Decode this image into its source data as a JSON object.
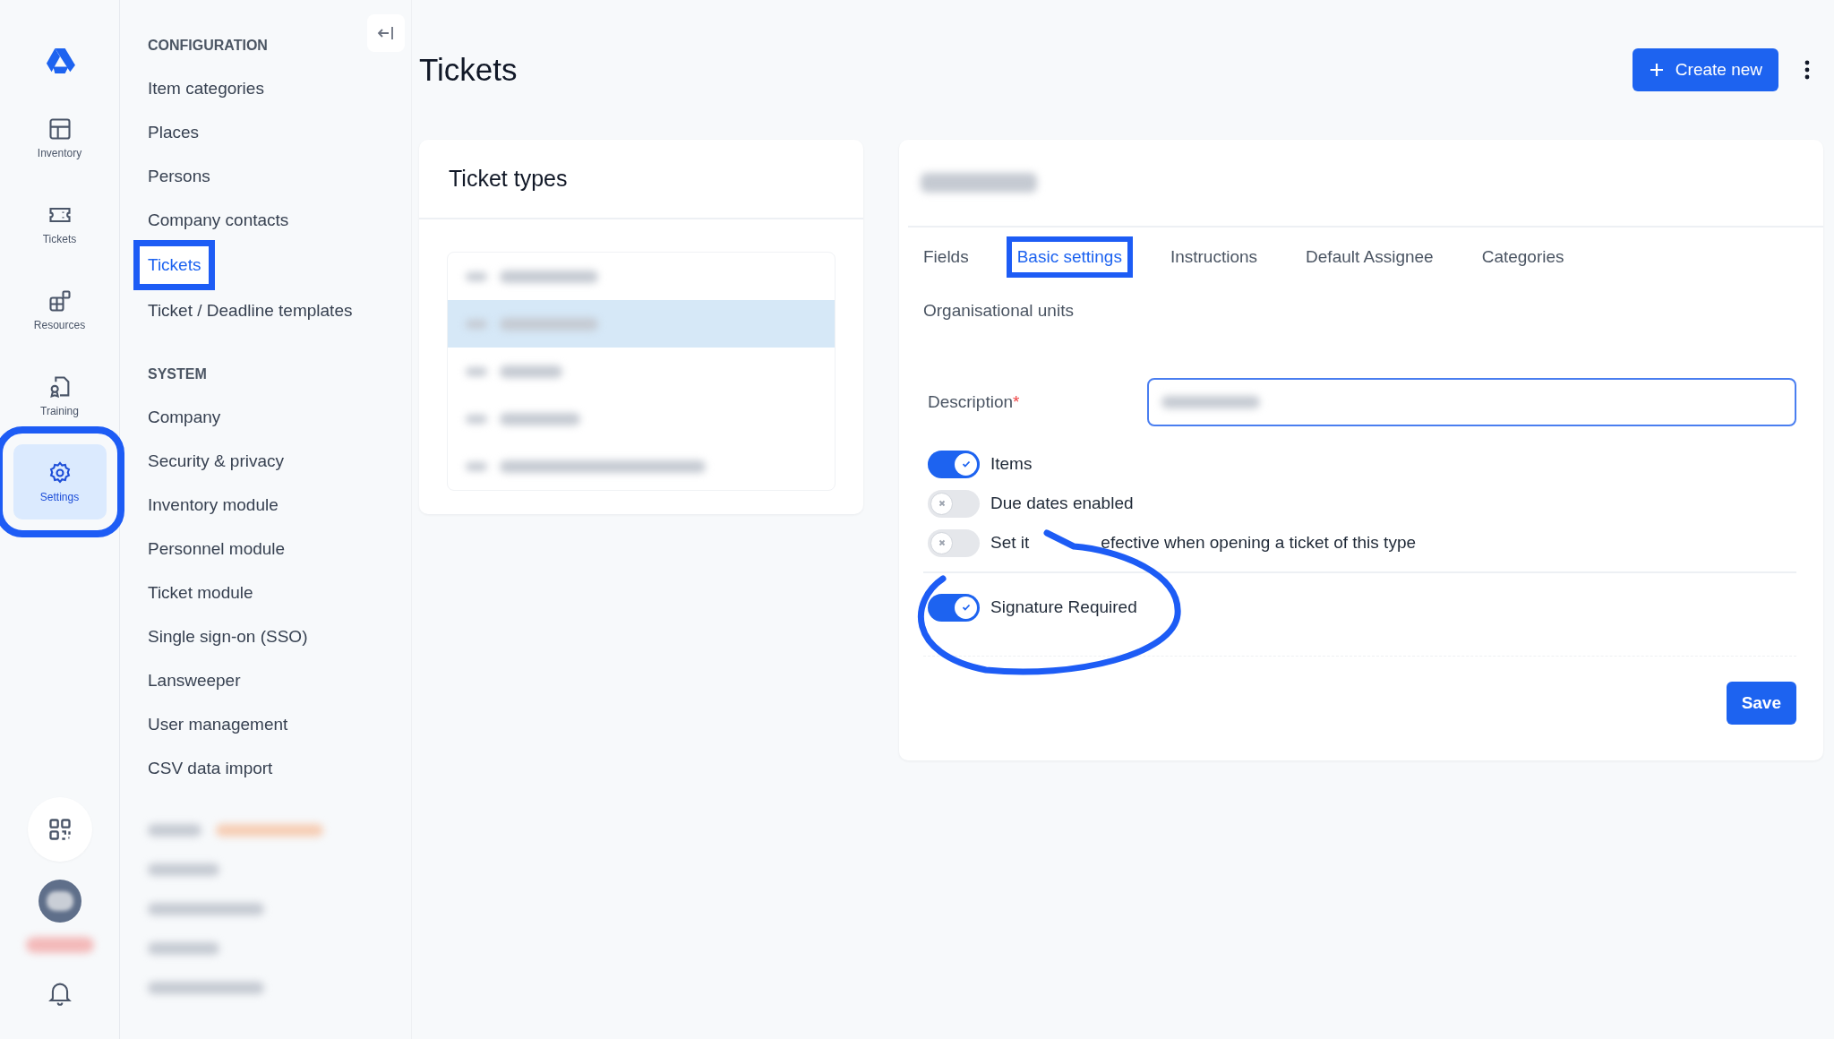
{
  "rail": {
    "items": [
      {
        "kind": "inventory",
        "label": "Inventory",
        "selected": false,
        "highlighted": false
      },
      {
        "kind": "tickets",
        "label": "Tickets",
        "selected": false,
        "highlighted": false
      },
      {
        "kind": "resources",
        "label": "Resources",
        "selected": false,
        "highlighted": false
      },
      {
        "kind": "training",
        "label": "Training",
        "selected": false,
        "highlighted": false
      },
      {
        "kind": "settings",
        "label": "Settings",
        "selected": true,
        "highlighted": true
      }
    ]
  },
  "sidebar": {
    "sections": [
      {
        "heading": "CONFIGURATION",
        "items": [
          {
            "label": "Item categories",
            "selected": false,
            "highlighted": false
          },
          {
            "label": "Places",
            "selected": false,
            "highlighted": false
          },
          {
            "label": "Persons",
            "selected": false,
            "highlighted": false
          },
          {
            "label": "Company contacts",
            "selected": false,
            "highlighted": false
          },
          {
            "label": "Tickets",
            "selected": true,
            "highlighted": true
          },
          {
            "label": "Ticket / Deadline templates",
            "selected": false,
            "highlighted": false
          }
        ]
      },
      {
        "heading": "SYSTEM",
        "items": [
          {
            "label": "Company",
            "selected": false,
            "highlighted": false
          },
          {
            "label": "Security & privacy",
            "selected": false,
            "highlighted": false
          },
          {
            "label": "Inventory module",
            "selected": false,
            "highlighted": false
          },
          {
            "label": "Personnel module",
            "selected": false,
            "highlighted": false
          },
          {
            "label": "Ticket module",
            "selected": false,
            "highlighted": false
          },
          {
            "label": "Single sign-on (SSO)",
            "selected": false,
            "highlighted": false
          },
          {
            "label": "Lansweeper",
            "selected": false,
            "highlighted": false
          },
          {
            "label": "User management",
            "selected": false,
            "highlighted": false
          },
          {
            "label": "CSV data import",
            "selected": false,
            "highlighted": false
          }
        ]
      }
    ]
  },
  "page": {
    "title": "Tickets",
    "create_button": "Create new"
  },
  "ticket_types": {
    "title": "Ticket types",
    "rows": [
      {
        "selected": false
      },
      {
        "selected": true
      },
      {
        "selected": false
      },
      {
        "selected": false
      },
      {
        "selected": false
      }
    ]
  },
  "detail": {
    "tab_rows": [
      [
        {
          "label": "Fields",
          "selected": false,
          "highlighted": false
        },
        {
          "label": "Basic settings",
          "selected": true,
          "highlighted": true
        },
        {
          "label": "Instructions",
          "selected": false,
          "highlighted": false
        },
        {
          "label": "Default Assignee",
          "selected": false,
          "highlighted": false
        },
        {
          "label": "Categories",
          "selected": false,
          "highlighted": false
        }
      ],
      [
        {
          "label": "Organisational units",
          "selected": false,
          "highlighted": false
        }
      ]
    ],
    "description": {
      "label": "Description",
      "required_mark": "*"
    },
    "toggle_groups": [
      {
        "toggles": [
          {
            "label": "Items",
            "on": true,
            "circled": false
          },
          {
            "label": "Due dates enabled",
            "on": false,
            "circled": false
          },
          {
            "label_parts": [
              "Set it",
              "efective when opening a ticket of this type"
            ],
            "on": false,
            "circled": false
          }
        ]
      },
      {
        "toggles": [
          {
            "label": "Signature Required",
            "on": true,
            "circled": true
          }
        ]
      }
    ],
    "save_button": "Save"
  }
}
